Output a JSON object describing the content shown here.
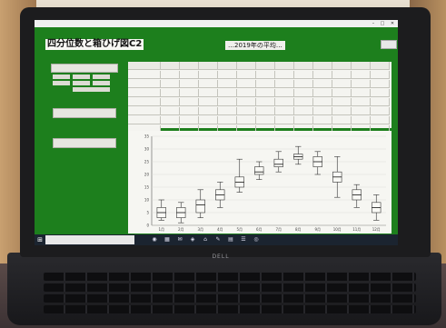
{
  "app": {
    "menu_text": "",
    "title": "四分位数と箱ひげ図C2",
    "subtitle": "…2019年の平均…",
    "close_label": "",
    "minimize_glyph": "–",
    "maximize_glyph": "□",
    "close_glyph": "✕"
  },
  "sidebar": {
    "buttons": [
      {
        "label": ""
      },
      {
        "label": ""
      },
      {
        "label": ""
      }
    ],
    "radios": [
      {
        "label": ""
      },
      {
        "label": ""
      },
      {
        "label": ""
      },
      {
        "label": ""
      },
      {
        "label": ""
      },
      {
        "label": ""
      },
      {
        "label": ""
      }
    ]
  },
  "table": {
    "columns": [
      "",
      "",
      "",
      "",
      "",
      "",
      "",
      "",
      "",
      "",
      "",
      "",
      ""
    ],
    "rows": [
      {
        "label": "",
        "cells": [
          "",
          "",
          "",
          "",
          "",
          "",
          "",
          "",
          "",
          "",
          "",
          ""
        ]
      },
      {
        "label": "",
        "cells": [
          "",
          "",
          "",
          "",
          "",
          "",
          "",
          "",
          "",
          "",
          "",
          ""
        ]
      },
      {
        "label": "",
        "cells": [
          "",
          "",
          "",
          "",
          "",
          "",
          "",
          "",
          "",
          "",
          "",
          ""
        ]
      },
      {
        "label": "",
        "cells": [
          "",
          "",
          "",
          "",
          "",
          "",
          "",
          "",
          "",
          "",
          "",
          ""
        ]
      },
      {
        "label": "",
        "cells": [
          "",
          "",
          "",
          "",
          "",
          "",
          "",
          "",
          "",
          "",
          "",
          ""
        ]
      },
      {
        "label": "",
        "cells": [
          "",
          "",
          "",
          "",
          "",
          "",
          "",
          "",
          "",
          "",
          "",
          ""
        ]
      },
      {
        "label": "",
        "cells": [
          "",
          "",
          "",
          "",
          "",
          "",
          "",
          "",
          "",
          "",
          "",
          ""
        ]
      }
    ]
  },
  "chart_data": {
    "type": "box",
    "title": "",
    "ylabel": "",
    "xlabel": "",
    "ylim": [
      0,
      35
    ],
    "categories": [
      "1月",
      "2月",
      "3月",
      "4月",
      "5月",
      "6月",
      "7月",
      "8月",
      "9月",
      "10月",
      "11月",
      "12月"
    ],
    "boxes": [
      {
        "min": 2,
        "q1": 3,
        "median": 5,
        "q3": 7,
        "max": 10
      },
      {
        "min": 1,
        "q1": 3,
        "median": 5,
        "q3": 7,
        "max": 9
      },
      {
        "min": 3,
        "q1": 5,
        "median": 8,
        "q3": 10,
        "max": 14
      },
      {
        "min": 7,
        "q1": 10,
        "median": 12,
        "q3": 14,
        "max": 17
      },
      {
        "min": 13,
        "q1": 15,
        "median": 17,
        "q3": 19,
        "max": 26
      },
      {
        "min": 18,
        "q1": 20,
        "median": 21,
        "q3": 23,
        "max": 25
      },
      {
        "min": 21,
        "q1": 23,
        "median": 24,
        "q3": 26,
        "max": 29
      },
      {
        "min": 24,
        "q1": 26,
        "median": 27,
        "q3": 28,
        "max": 31
      },
      {
        "min": 20,
        "q1": 23,
        "median": 25,
        "q3": 27,
        "max": 29
      },
      {
        "min": 11,
        "q1": 17,
        "median": 19,
        "q3": 21,
        "max": 27
      },
      {
        "min": 7,
        "q1": 10,
        "median": 12,
        "q3": 14,
        "max": 16
      },
      {
        "min": 2,
        "q1": 5,
        "median": 7,
        "q3": 9,
        "max": 12
      }
    ]
  },
  "taskbar": {
    "start_glyph": "⊞",
    "search_placeholder": "",
    "pinned": [
      "◉",
      "▦",
      "✉",
      "◈",
      "⌂",
      "✎",
      "▤",
      "☰",
      "◎"
    ],
    "tray_text": ""
  },
  "laptop": {
    "brand": "DELL"
  }
}
